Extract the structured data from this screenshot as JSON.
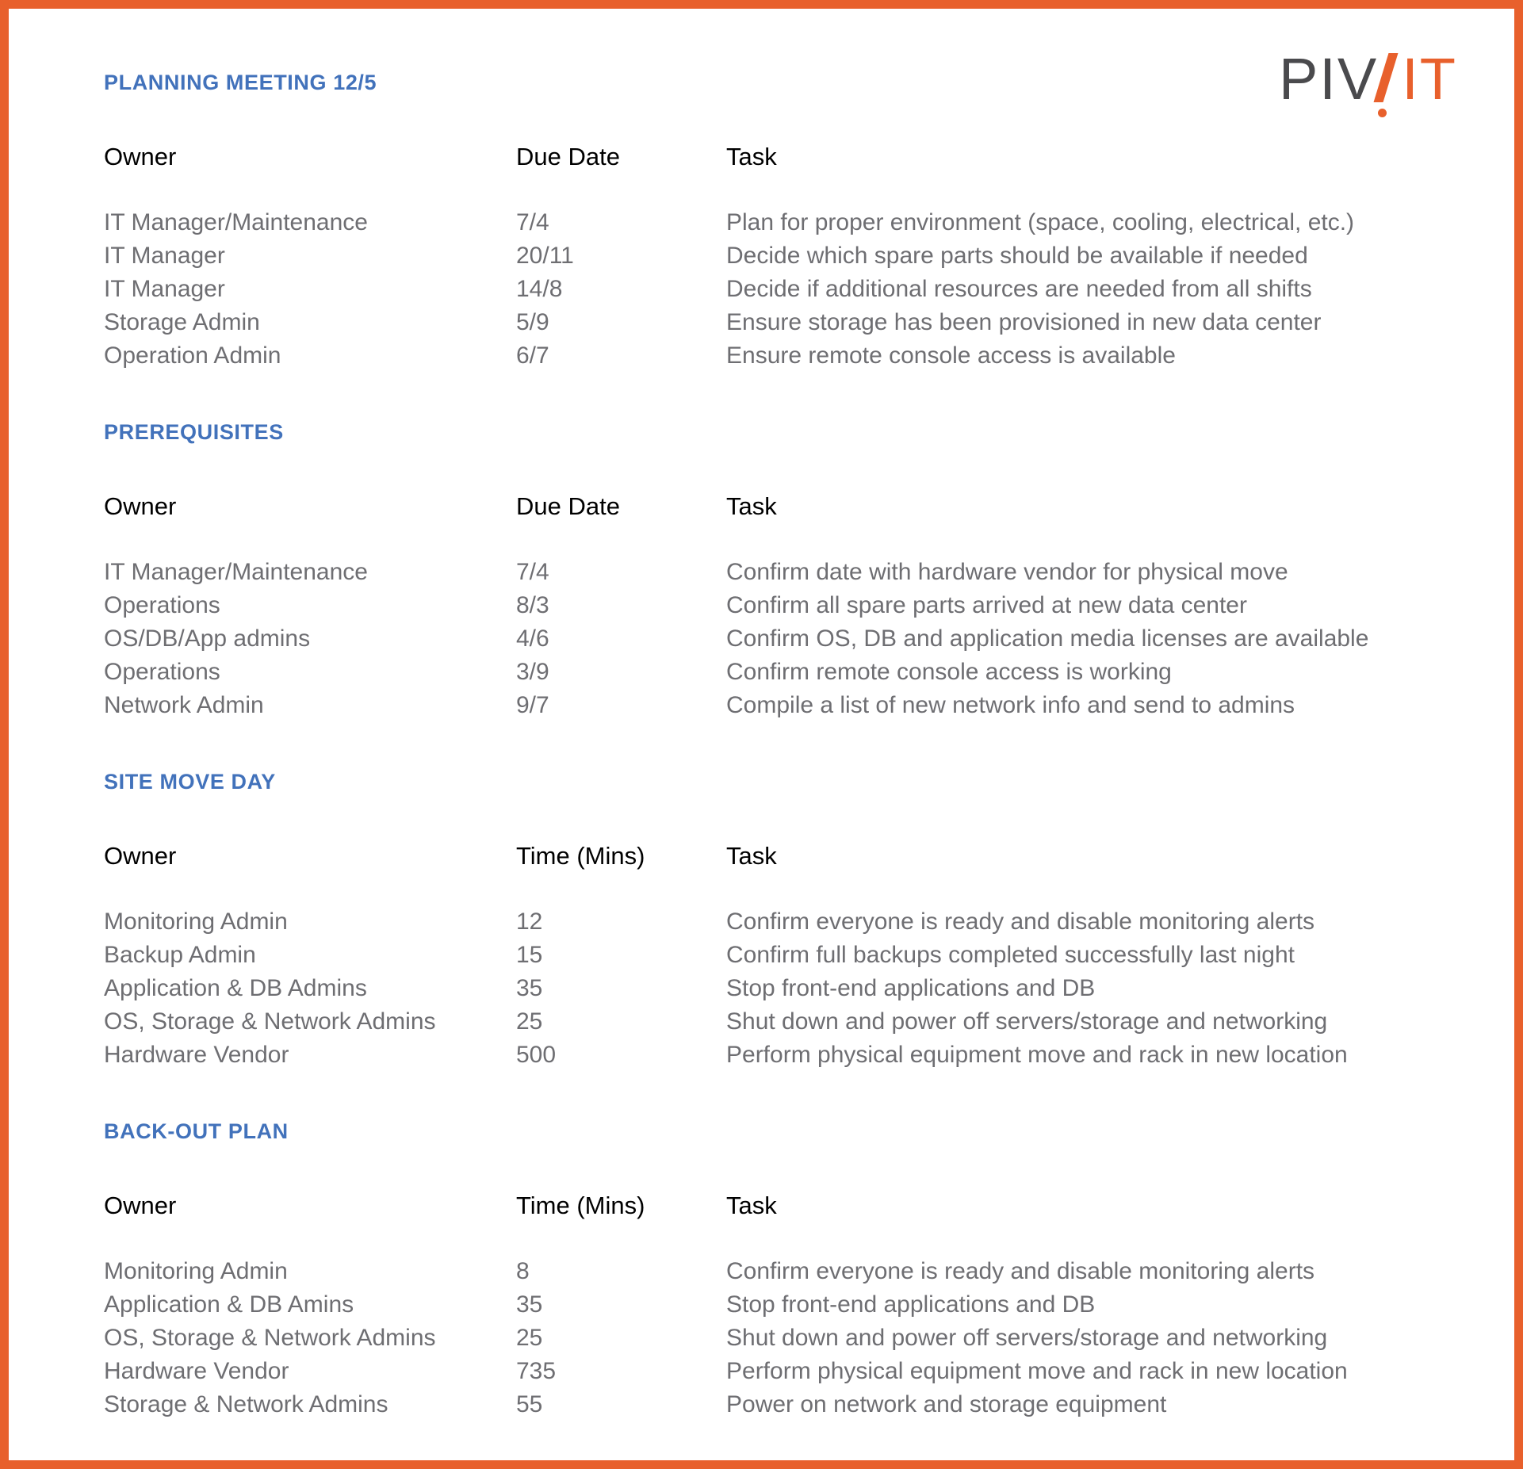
{
  "logo": {
    "part1": "PIV",
    "part2": "IT",
    "mark": "exclamation-slash-mark",
    "color_dark": "#4a4a4d",
    "color_accent": "#e8602c"
  },
  "theme": {
    "heading_blue": "#4272bb",
    "body_gray": "#6e6e72",
    "border_orange": "#e8602c"
  },
  "sections": [
    {
      "title": "PLANNING MEETING 12/5",
      "columns": [
        "Owner",
        "Due Date",
        "Task"
      ],
      "rows": [
        [
          "IT Manager/Maintenance",
          "7/4",
          "Plan for proper environment (space, cooling, electrical, etc.)"
        ],
        [
          "IT Manager",
          "20/11",
          "Decide which spare parts should be available if needed"
        ],
        [
          "IT Manager",
          "14/8",
          "Decide if additional resources are needed from all shifts"
        ],
        [
          "Storage Admin",
          "5/9",
          "Ensure storage has been provisioned in new data center"
        ],
        [
          "Operation Admin",
          "6/7",
          "Ensure remote console access is available"
        ]
      ]
    },
    {
      "title": "PREREQUISITES",
      "columns": [
        "Owner",
        "Due Date",
        "Task"
      ],
      "rows": [
        [
          "IT Manager/Maintenance",
          "7/4",
          "Confirm date with hardware vendor for physical move"
        ],
        [
          "Operations",
          "8/3",
          "Confirm all spare parts arrived at new data center"
        ],
        [
          "OS/DB/App admins",
          "4/6",
          "Confirm OS, DB and application media licenses are available"
        ],
        [
          "Operations",
          "3/9",
          "Confirm remote console access is working"
        ],
        [
          "Network Admin",
          "9/7",
          "Compile a list of new network info and send to admins"
        ]
      ]
    },
    {
      "title": "SITE MOVE DAY",
      "columns": [
        "Owner",
        "Time (Mins)",
        "Task"
      ],
      "rows": [
        [
          "Monitoring Admin",
          "12",
          "Confirm everyone is ready and disable monitoring alerts"
        ],
        [
          "Backup Admin",
          "15",
          "Confirm full backups completed successfully last night"
        ],
        [
          "Application & DB Admins",
          "35",
          "Stop front-end applications and DB"
        ],
        [
          "OS, Storage & Network Admins",
          "25",
          "Shut down and power off servers/storage and networking"
        ],
        [
          "Hardware Vendor",
          "500",
          "Perform physical equipment move and rack in new location"
        ]
      ]
    },
    {
      "title": "BACK-OUT PLAN",
      "columns": [
        "Owner",
        "Time (Mins)",
        "Task"
      ],
      "rows": [
        [
          "Monitoring Admin",
          "8",
          "Confirm everyone is ready and disable monitoring alerts"
        ],
        [
          "Application & DB Amins",
          "35",
          "Stop front-end applications and DB"
        ],
        [
          "OS, Storage & Network Admins",
          "25",
          "Shut down and power off servers/storage and networking"
        ],
        [
          "Hardware Vendor",
          "735",
          "Perform physical equipment move and rack in new location"
        ],
        [
          "Storage & Network Admins",
          "55",
          "Power on network and storage equipment"
        ]
      ]
    }
  ]
}
